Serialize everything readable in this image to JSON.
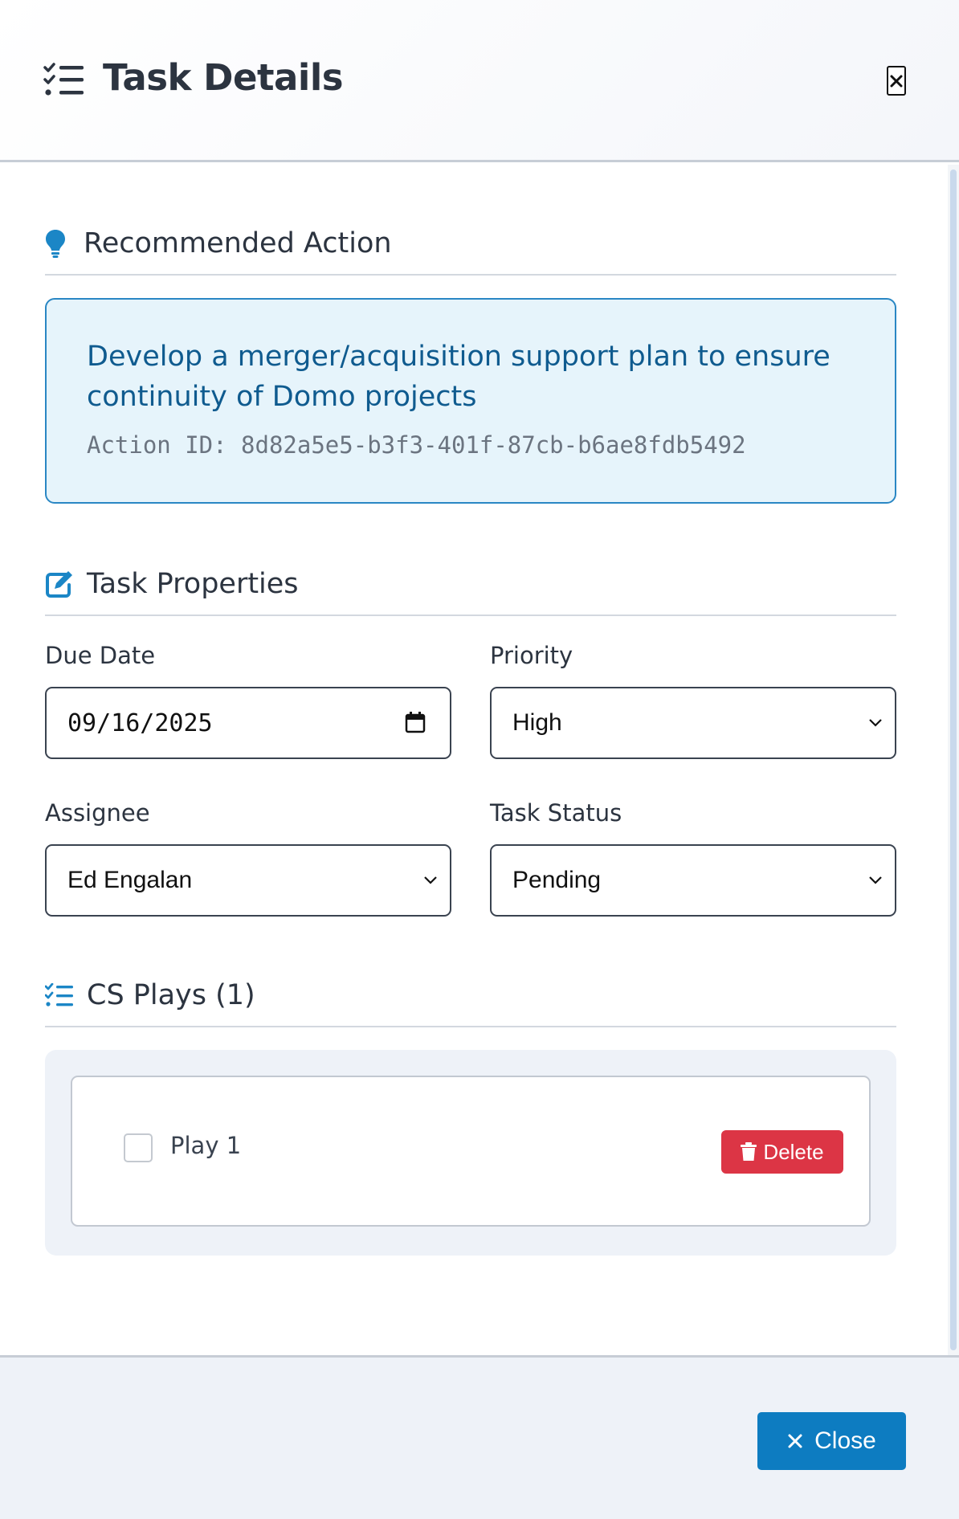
{
  "header": {
    "title": "Task Details",
    "icon": "list-check-icon",
    "close_icon": "close-icon"
  },
  "recommended_action": {
    "heading": "Recommended Action",
    "icon": "lightbulb-icon",
    "text": "Develop a merger/acquisition support plan to ensure continuity of Domo projects",
    "action_id": "Action ID: 8d82a5e5-b3f3-401f-87cb-b6ae8fdb5492"
  },
  "task_properties": {
    "heading": "Task Properties",
    "icon": "edit-icon",
    "due_date": {
      "label": "Due Date",
      "value": "09/16/2025"
    },
    "priority": {
      "label": "Priority",
      "value": "High"
    },
    "assignee": {
      "label": "Assignee",
      "value": "Ed Engalan"
    },
    "status": {
      "label": "Task Status",
      "value": "Pending"
    }
  },
  "cs_plays": {
    "heading": "CS Plays (1)",
    "icon": "list-check-icon",
    "items": [
      {
        "label": "Play 1",
        "checked": false,
        "delete_label": "Delete"
      }
    ]
  },
  "footer": {
    "close_label": "Close"
  },
  "colors": {
    "accent": "#0d7cc1",
    "danger": "#dc3545",
    "action_text": "#0f5b8f",
    "action_bg": "#e6f4fb"
  }
}
